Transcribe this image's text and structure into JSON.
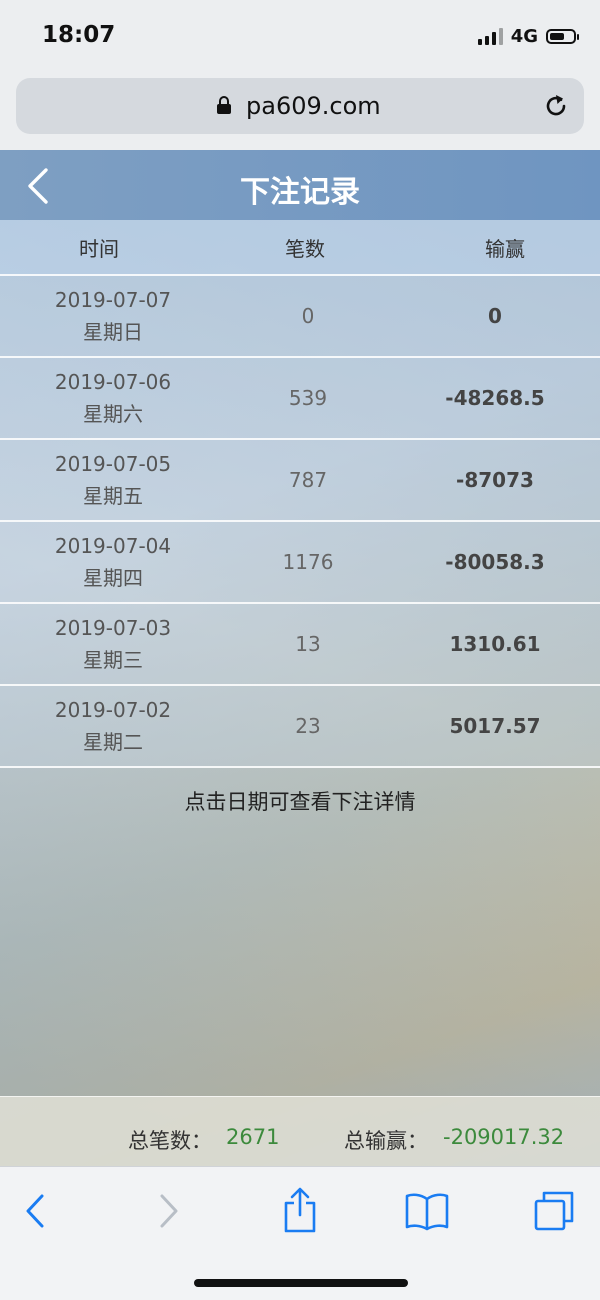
{
  "status_bar": {
    "time": "18:07",
    "network": "4G"
  },
  "browser": {
    "url": "pa609.com"
  },
  "page": {
    "title": "下注记录",
    "table": {
      "headers": [
        "时间",
        "笔数",
        "输赢"
      ],
      "rows": [
        {
          "date": "2019-07-07",
          "weekday": "星期日",
          "count": "0",
          "win": "0"
        },
        {
          "date": "2019-07-06",
          "weekday": "星期六",
          "count": "539",
          "win": "-48268.5"
        },
        {
          "date": "2019-07-05",
          "weekday": "星期五",
          "count": "787",
          "win": "-87073"
        },
        {
          "date": "2019-07-04",
          "weekday": "星期四",
          "count": "1176",
          "win": "-80058.3"
        },
        {
          "date": "2019-07-03",
          "weekday": "星期三",
          "count": "13",
          "win": "1310.61"
        },
        {
          "date": "2019-07-02",
          "weekday": "星期二",
          "count": "23",
          "win": "5017.57"
        }
      ]
    },
    "hint": "点击日期可查看下注详情",
    "summary": {
      "count_label": "总笔数：",
      "count_value": "2671",
      "win_label": "总输赢：",
      "win_value": "-209017.32"
    }
  },
  "colors": {
    "nav_bar": "#7e9fc2",
    "summary_value": "#3c8a3c",
    "toolbar_icon": "#1a7cf2"
  },
  "icons": {
    "back": "chevron-left-icon",
    "lock": "lock-icon",
    "reload": "reload-icon",
    "share": "share-icon",
    "bookmarks": "book-icon",
    "tabs": "tabs-icon"
  }
}
